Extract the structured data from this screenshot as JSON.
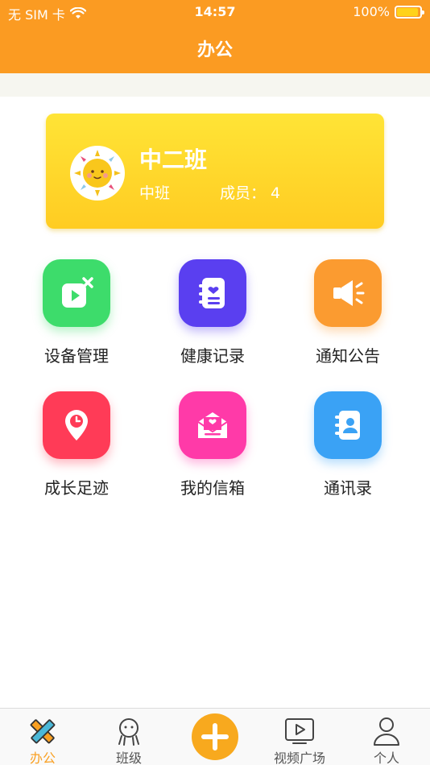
{
  "status_bar": {
    "carrier": "无 SIM 卡",
    "time": "14:57",
    "battery": "100%"
  },
  "nav": {
    "title": "办公"
  },
  "class_card": {
    "name": "中二班",
    "grade": "中班",
    "members": "成员：  4"
  },
  "grid": [
    {
      "label": "设备管理",
      "color": "#3ddc6b",
      "icon": "device-management-icon"
    },
    {
      "label": "健康记录",
      "color": "#5a3ff0",
      "icon": "health-record-icon"
    },
    {
      "label": "通知公告",
      "color": "#fb9b30",
      "icon": "megaphone-icon"
    },
    {
      "label": "成长足迹",
      "color": "#ff3b57",
      "icon": "location-clock-icon"
    },
    {
      "label": "我的信箱",
      "color": "#ff3aa8",
      "icon": "mailbox-icon"
    },
    {
      "label": "通讯录",
      "color": "#3aa2f5",
      "icon": "contacts-icon"
    }
  ],
  "tabbar": {
    "items": [
      {
        "label": "办公",
        "active": true,
        "icon": "pencil-ruler-icon"
      },
      {
        "label": "班级",
        "active": false,
        "icon": "class-people-icon"
      },
      {
        "label": "",
        "active": false,
        "icon": "add-icon"
      },
      {
        "label": "视频广场",
        "active": false,
        "icon": "video-play-icon"
      },
      {
        "label": "个人",
        "active": false,
        "icon": "person-icon"
      }
    ],
    "active_color": "#f9a022"
  }
}
